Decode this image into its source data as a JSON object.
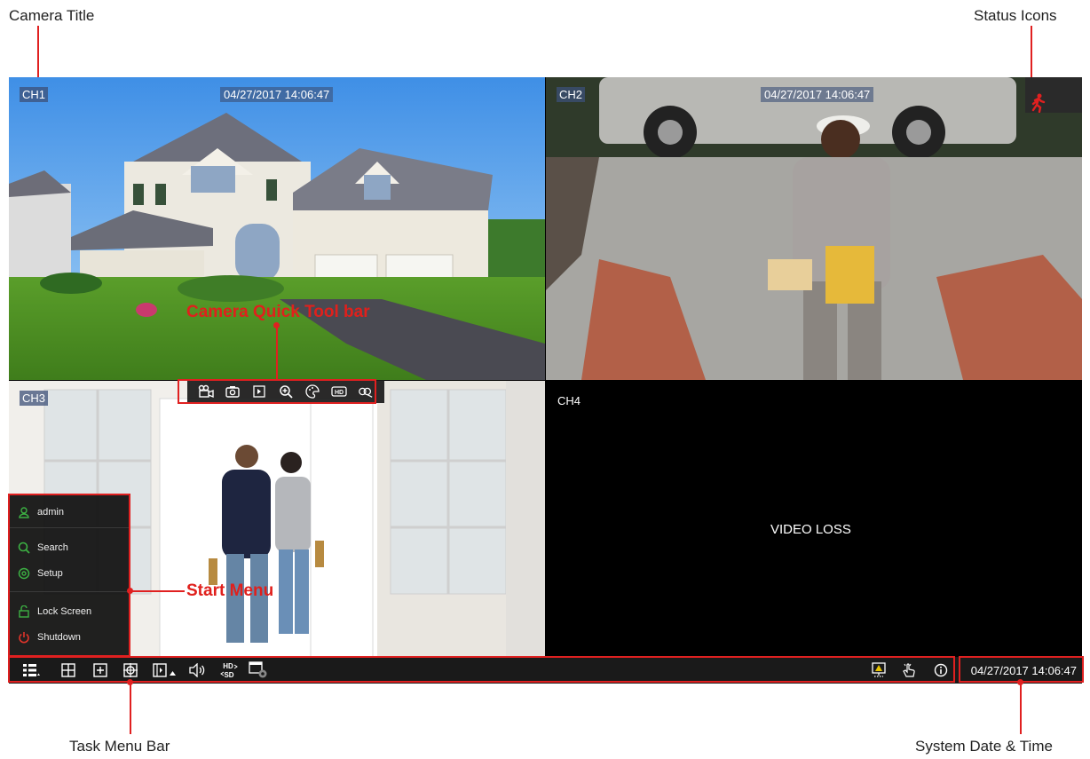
{
  "callouts": {
    "camera_title": "Camera Title",
    "status_icons": "Status Icons",
    "camera_quick_tool_bar": "Camera Quick Tool bar",
    "start_menu": "Start Menu",
    "task_menu_bar": "Task Menu Bar",
    "system_date_time": "System Date & Time"
  },
  "cameras": {
    "ch1": {
      "title": "CH1",
      "time": "04/27/2017 14:06:47"
    },
    "ch2": {
      "title": "CH2",
      "time": "04/27/2017 14:06:47"
    },
    "ch3": {
      "title": "CH3"
    },
    "ch4": {
      "title": "CH4",
      "message": "VIDEO LOSS"
    }
  },
  "quick_toolbar": {
    "icons": [
      "record-icon",
      "snapshot-icon",
      "playback-icon",
      "zoom-icon",
      "color-icon",
      "hd-icon",
      "stream-icon"
    ]
  },
  "start_menu": {
    "user": "admin",
    "items": [
      "Search",
      "Setup",
      "Lock Screen",
      "Shutdown"
    ]
  },
  "taskbar": {
    "icons": [
      "menu-icon",
      "quad-view-icon",
      "single-view-icon",
      "sequence-view-icon",
      "pip-icon",
      "volume-icon",
      "hd-sd-icon",
      "camera-settings-icon",
      "alarm-icon",
      "hand-icon",
      "info-icon"
    ],
    "hd_label": "HD",
    "sd_label": "SD",
    "hd_badge": "HD",
    "system_time": "04/27/2017 14:06:47"
  },
  "colors": {
    "annotation_red": "#e02020",
    "menu_green": "#3cb043",
    "shutdown_red": "#e0342a"
  }
}
